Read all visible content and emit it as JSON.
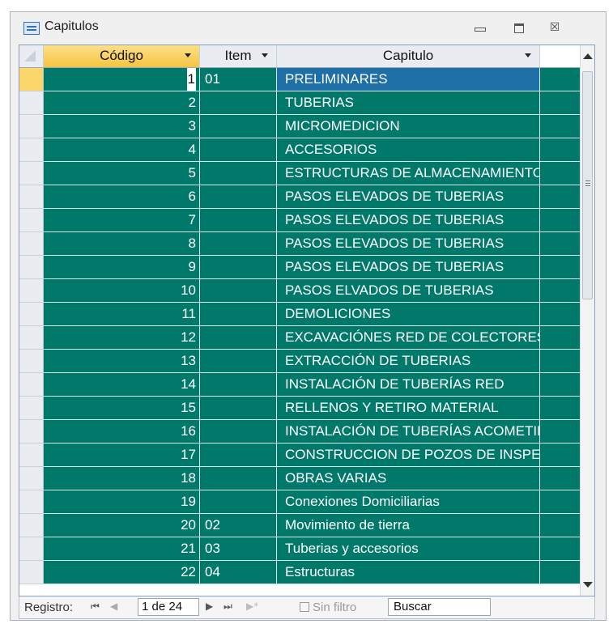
{
  "window": {
    "title": "Capitulos",
    "minimize_glyph": "",
    "maximize_glyph": "",
    "close_glyph": "☒"
  },
  "columns": {
    "codigo": "Código",
    "item": "Item",
    "capitulo": "Capitulo"
  },
  "rows": [
    {
      "codigo": "1",
      "item": "01",
      "capitulo": "PRELIMINARES"
    },
    {
      "codigo": "2",
      "item": "",
      "capitulo": "TUBERIAS"
    },
    {
      "codigo": "3",
      "item": "",
      "capitulo": "MICROMEDICION"
    },
    {
      "codigo": "4",
      "item": "",
      "capitulo": "ACCESORIOS"
    },
    {
      "codigo": "5",
      "item": "",
      "capitulo": "ESTRUCTURAS DE ALMACENAMIENTO"
    },
    {
      "codigo": "6",
      "item": "",
      "capitulo": "PASOS ELEVADOS DE TUBERIAS"
    },
    {
      "codigo": "7",
      "item": "",
      "capitulo": "PASOS ELEVADOS DE TUBERIAS"
    },
    {
      "codigo": "8",
      "item": "",
      "capitulo": "PASOS ELEVADOS DE TUBERIAS"
    },
    {
      "codigo": "9",
      "item": "",
      "capitulo": "PASOS ELEVADOS DE TUBERIAS"
    },
    {
      "codigo": "10",
      "item": "",
      "capitulo": "PASOS ELVADOS DE TUBERIAS"
    },
    {
      "codigo": "11",
      "item": "",
      "capitulo": "DEMOLICIONES"
    },
    {
      "codigo": "12",
      "item": "",
      "capitulo": "EXCAVACIÓNES RED DE COLECTORES"
    },
    {
      "codigo": "13",
      "item": "",
      "capitulo": "EXTRACCIÓN DE TUBERIAS"
    },
    {
      "codigo": "14",
      "item": "",
      "capitulo": "INSTALACIÓN DE TUBERÍAS RED"
    },
    {
      "codigo": "15",
      "item": "",
      "capitulo": "RELLENOS Y RETIRO MATERIAL"
    },
    {
      "codigo": "16",
      "item": "",
      "capitulo": "INSTALACIÓN DE TUBERÍAS ACOMETIDAS"
    },
    {
      "codigo": "17",
      "item": "",
      "capitulo": "CONSTRUCCION DE POZOS DE INSPECCION"
    },
    {
      "codigo": "18",
      "item": "",
      "capitulo": "OBRAS VARIAS"
    },
    {
      "codigo": "19",
      "item": "",
      "capitulo": "Conexiones Domiciliarias"
    },
    {
      "codigo": "20",
      "item": "02",
      "capitulo": "Movimiento de tierra"
    },
    {
      "codigo": "21",
      "item": "03",
      "capitulo": "Tuberias y accesorios"
    },
    {
      "codigo": "22",
      "item": "04",
      "capitulo": "Estructuras"
    }
  ],
  "navigation": {
    "label": "Registro:",
    "first": "⏮",
    "prev": "◀",
    "record": "1 de 24",
    "next": "▶",
    "last": "⏭",
    "new": "▶*",
    "filter": "Sin filtro",
    "search": "Buscar"
  },
  "colors": {
    "row_bg": "#00796b",
    "selected_cell": "#1d6fa5",
    "active_header": "#f5c53f"
  }
}
